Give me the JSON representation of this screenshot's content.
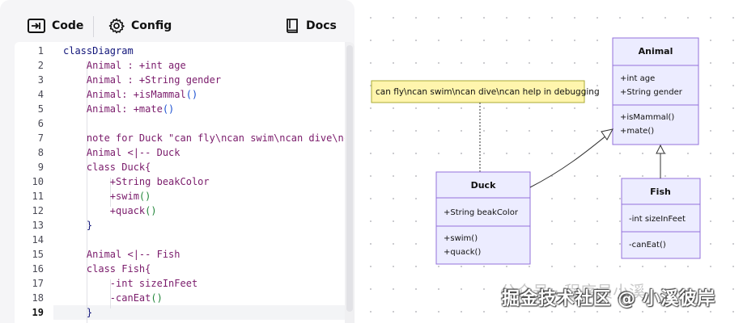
{
  "tabs": [
    {
      "label": "Code",
      "icon": "code-arrow-icon"
    },
    {
      "label": "Config",
      "icon": "gear-icon"
    },
    {
      "label": "Docs",
      "icon": "book-icon"
    }
  ],
  "editor": {
    "line_numbers": [
      "1",
      "2",
      "3",
      "4",
      "5",
      "6",
      "7",
      "8",
      "9",
      "10",
      "11",
      "12",
      "13",
      "14",
      "15",
      "16",
      "17",
      "18",
      "19"
    ],
    "active_line": 19,
    "lines": [
      [
        {
          "t": "classDiagram",
          "c": "kw-class"
        }
      ],
      [
        {
          "t": "    Animal : +",
          "c": "kw-name"
        },
        {
          "t": "int age",
          "c": "kw-name"
        }
      ],
      [
        {
          "t": "    Animal : +",
          "c": "kw-name"
        },
        {
          "t": "String gender",
          "c": "kw-name"
        }
      ],
      [
        {
          "t": "    Animal: +",
          "c": "kw-name"
        },
        {
          "t": "isMammal",
          "c": "kw-name"
        },
        {
          "t": "()",
          "c": "kw-call"
        }
      ],
      [
        {
          "t": "    Animal: +",
          "c": "kw-name"
        },
        {
          "t": "mate",
          "c": "kw-name"
        },
        {
          "t": "()",
          "c": "kw-call"
        }
      ],
      [
        {
          "t": "",
          "c": "kw-name"
        }
      ],
      [
        {
          "t": "    note for Duck \"can fly\\ncan swim\\ncan dive\\nca",
          "c": "kw-str"
        }
      ],
      [
        {
          "t": "    Animal <|-- Duck",
          "c": "kw-name"
        }
      ],
      [
        {
          "t": "    class Duck{",
          "c": "kw-name"
        }
      ],
      [
        {
          "t": "        +String beakColor",
          "c": "kw-name"
        }
      ],
      [
        {
          "t": "        +swim",
          "c": "kw-name"
        },
        {
          "t": "()",
          "c": "kw-green"
        }
      ],
      [
        {
          "t": "        +quack",
          "c": "kw-name"
        },
        {
          "t": "()",
          "c": "kw-green"
        }
      ],
      [
        {
          "t": "    }",
          "c": "kw-brace"
        }
      ],
      [
        {
          "t": "",
          "c": "kw-name"
        }
      ],
      [
        {
          "t": "    Animal <|-- Fish",
          "c": "kw-name"
        }
      ],
      [
        {
          "t": "    class Fish{",
          "c": "kw-name"
        }
      ],
      [
        {
          "t": "        -int sizeInFeet",
          "c": "kw-name"
        }
      ],
      [
        {
          "t": "        -canEat",
          "c": "kw-name"
        },
        {
          "t": "()",
          "c": "kw-green"
        }
      ],
      [
        {
          "t": "    }",
          "c": "kw-brace"
        }
      ]
    ]
  },
  "diagram": {
    "note": "can fly\\ncan swim\\ncan dive\\ncan help in debugging",
    "animal": {
      "name": "Animal",
      "attrs": [
        "+int age",
        "+String gender"
      ],
      "methods": [
        "+isMammal()",
        "+mate()"
      ]
    },
    "duck": {
      "name": "Duck",
      "attrs": [
        "+String beakColor"
      ],
      "methods": [
        "+swim()",
        "+quack()"
      ]
    },
    "fish": {
      "name": "Fish",
      "attrs": [
        "-int sizeInFeet"
      ],
      "methods": [
        "-canEat()"
      ]
    },
    "colors": {
      "box_fill": "#ececff",
      "box_stroke": "#9370db",
      "note_fill": "#fff5ad",
      "note_stroke": "#aaaa33"
    }
  },
  "watermark": {
    "line1": "公众号 · 程序员小溪",
    "line2": "掘金技术社区 @ 小溪彼岸"
  }
}
